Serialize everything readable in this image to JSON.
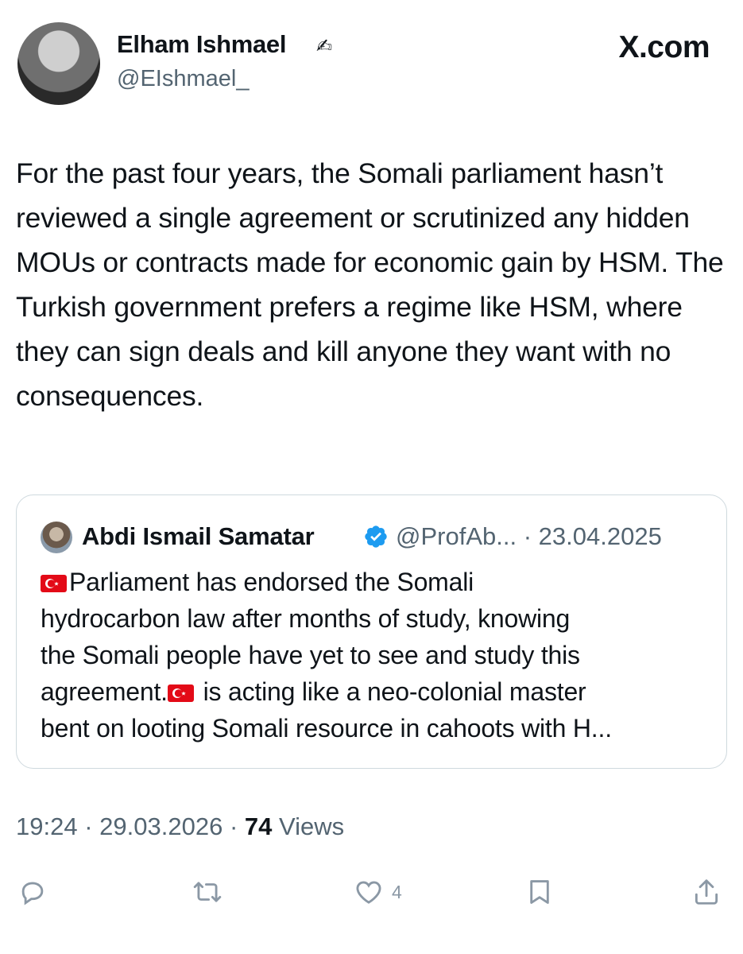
{
  "header": {
    "display_name": "Elham Ishmael",
    "name_emoji": "✍",
    "handle": "@EIshmael_",
    "brand": "X.com"
  },
  "tweet": {
    "text": "For the past four years, the Somali parliament hasn’t reviewed a single agreement or scrutinized any hidden MOUs or contracts made for economic gain by HSM. The Turkish government prefers a regime like HSM, where they can sign deals and kill anyone they want with no consequences."
  },
  "quote": {
    "name": "Abdi Ismail Samatar",
    "handle": "@ProfAb...",
    "separator": "·",
    "date": "23.04.2025",
    "lines": [
      "Parliament has endorsed the Somali",
      "hydrocarbon law after months of study, knowing",
      "the Somali people have yet to see and study this",
      "agreement.",
      " is acting like a neo-colonial master",
      "bent on looting Somali resource in cahoots with H..."
    ]
  },
  "meta": {
    "time": "19:24",
    "separator": "·",
    "date": "29.03.2026",
    "views_count": "74",
    "views_label": "Views"
  },
  "actions": {
    "reply_icon": "reply-icon",
    "retweet_icon": "retweet-icon",
    "like_icon": "heart-icon",
    "like_count": "4",
    "bookmark_icon": "bookmark-icon",
    "share_icon": "share-icon"
  },
  "colors": {
    "text": "#0f1419",
    "secondary": "#536471",
    "border": "#cfd9de",
    "verified": "#1d9bf0",
    "flag": "#e30a17"
  }
}
